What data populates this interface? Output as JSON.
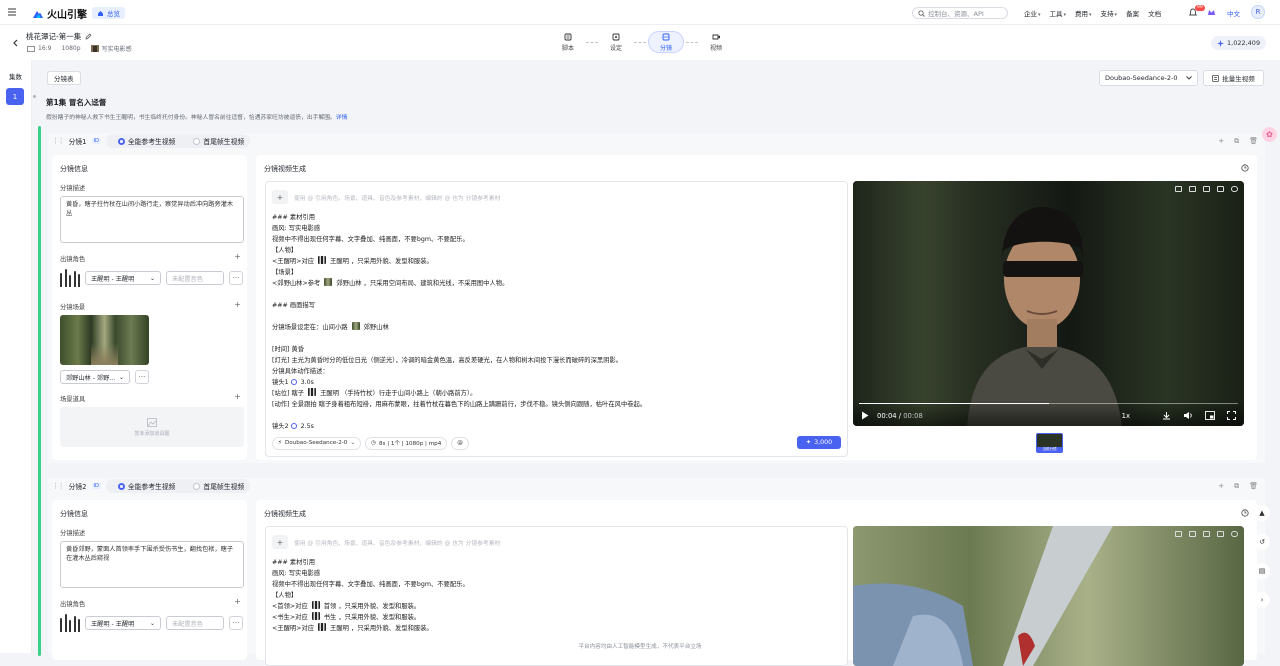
{
  "topbar": {
    "brand": "火山引擎",
    "home_label": "总览",
    "search_placeholder": "控制台、资源、API",
    "nav": [
      "企业",
      "工具",
      "费用",
      "支持",
      "备案",
      "文档"
    ],
    "bell_badge": "99",
    "lang": "中文",
    "avatar_letter": "R"
  },
  "project": {
    "title": "桃花潭记-第一集",
    "ratio": "16:9",
    "resolution": "1080p",
    "style": "写实电影感",
    "steps": [
      {
        "label": "脚本",
        "icon": "script-icon"
      },
      {
        "label": "设定",
        "icon": "settings-icon"
      },
      {
        "label": "分镜",
        "icon": "storyboard-icon",
        "active": true
      },
      {
        "label": "视频",
        "icon": "video-icon"
      }
    ],
    "credits": "1,022,409"
  },
  "rail": {
    "label": "集数",
    "episode": "1"
  },
  "toolbar": {
    "table_tab": "分镜表",
    "model": "Doubao-Seedance-2-0",
    "batch_label": "批量生视频"
  },
  "episode": {
    "title": "第1集  冒名入迳督",
    "summary": "假扮瞎子的神秘人救下书生王醒明，书生临终托付身份。神秘人冒名前往迳督，恰遇苏家旺坊被逼债，出手解围。",
    "detail_link": "详情"
  },
  "shots": [
    {
      "name": "分镜1",
      "id_tag": "ID",
      "mode_a": "全能参考生视频",
      "mode_b": "首尾帧生视频",
      "info_title": "分镜信息",
      "desc_label": "分镜描述",
      "desc": "黄昏，瞎子拄竹杖在山间小路行走，察觉异动后冲向路旁灌木丛",
      "char_label": "出镜角色",
      "char_select": "王醒明 - 王醒明",
      "voice_placeholder": "未配置音色",
      "scene_label": "分镜场景",
      "scene_select": "郊野山林 - 郊野...",
      "prop_label": "场景道具",
      "prop_placeholder": "暂未添加道具图",
      "gen_title": "分镜视频生成",
      "editor_placeholder": "使用 @ 引用角色、场景、道具、音色及参考素材，编辑的 @ 也为 分镜参考素材",
      "editor_lines": [
        "### 素材引用",
        "画风: 写实电影感",
        "视频中不得出现任何字幕、文字叠加、纯画面，不要bgm、不要配乐。",
        "【人物】",
        "<王醒明>对应 [char] 王醒明 ，只采用外貌、发型和服装。",
        "【场景】",
        "<郊野山林>参考 [scene] 郊野山林 ，只采用空间布局、建筑和光线，不采用图中人物。",
        "",
        "### 画面描写",
        "",
        "分镜场景设定在：山间小路 [scene] 郊野山林",
        "",
        "[时间] 黄昏",
        "[灯光] 主光为黄昏时分的低位日光（侧逆光），冷调的暗金黄色温，高反差硬光，在人物和树木间投下漫长而破碎的深黑阴影。",
        "分镜具体动作描述：",
        "镜头1 [clock] 3.0s",
        "[站位] 瞎子 [char] 王醒明 （手持竹杖）行走于山间小路上（朝小路前方）。",
        "[动作] 全景跟拍 瞎子身着粗布短褂，用麻布蒙眼，拄着竹杖在暮色下的山路上蹒跚前行，步伐不稳。镜头侧向跟随，枯叶在风中卷起。",
        "",
        "镜头2 [clock] 2.5s"
      ],
      "foot_model": "Doubao-Seedance-2-0",
      "foot_spec": "8s | 1个 | 1080p | mp4",
      "foot_at": "@",
      "gen_cost": "3,000",
      "video_time": "00:04",
      "video_duration": "00:08",
      "video_speed": "1x",
      "thumb_label": "当前分镜"
    },
    {
      "name": "分镜2",
      "id_tag": "ID",
      "mode_a": "全能参考生视频",
      "mode_b": "首尾帧生视频",
      "info_title": "分镜信息",
      "desc_label": "分镜描述",
      "desc": "黄昏郊野，蒙面人首领率手下围杀受伤书生，翻找包袱，瞎子在灌木丛后窥视",
      "char_label": "出镜角色",
      "char_select": "王醒明 - 王醒明",
      "voice_placeholder": "未配置音色",
      "gen_title": "分镜视频生成",
      "editor_placeholder": "使用 @ 引用角色、场景、道具、音色及参考素材，编辑的 @ 也为 分镜参考素材",
      "editor_lines": [
        "### 素材引用",
        "画风: 写实电影感",
        "视频中不得出现任何字幕、文字叠加、纯画面，不要bgm、不要配乐。",
        "【人物】",
        "<首领>对应 [char] 首领 ，只采用外貌、发型和服装。",
        "<书生>对应 [char] 书生 ，只采用外貌、发型和服装。",
        "<王醒明>对应 [char] 王醒明 ，只采用外貌、发型和服装。"
      ]
    }
  ],
  "footer": "平台内容均由人工智能模型生成，不代表平台立场"
}
